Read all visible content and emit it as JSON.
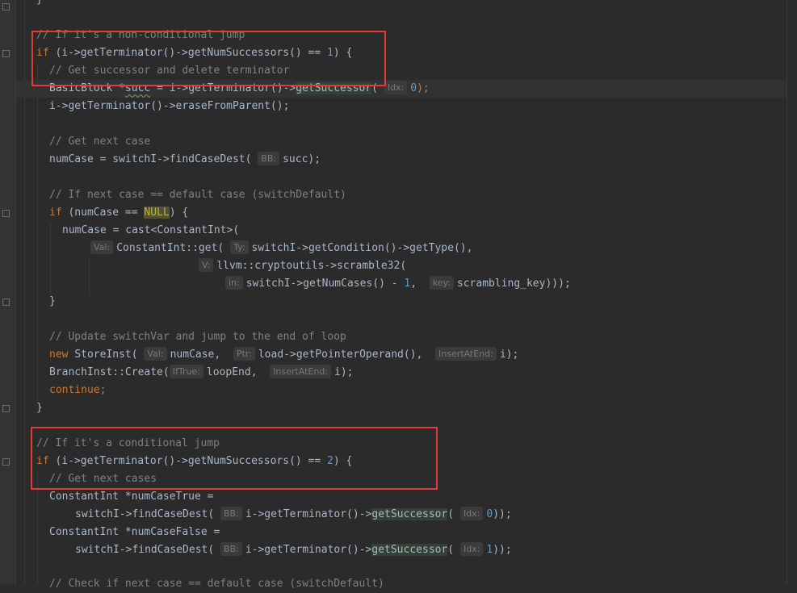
{
  "code": {
    "l1_comment": "// If it's a non-conditional jump",
    "l2_if": "if",
    "l2_a": " (i->getTerminator()->getNumSuccessors() == ",
    "l2_num": "1",
    "l2_b": ") {",
    "l3_comment": "// Get successor and delete terminator",
    "l4_a": "BasicBlock *",
    "l4_succ": "succ",
    "l4_b": " = i->getTerminator()->",
    "l4_fn": "getSuccessor",
    "l4_c": "(",
    "l4_hint": "Idx:",
    "l4_num": "0",
    "l4_d": ");",
    "l5": "i->getTerminator()->eraseFromParent();",
    "l7_comment": "// Get next case",
    "l8_a": "numCase = switchI->findCaseDest(",
    "l8_hint": "BB:",
    "l8_b": "succ);",
    "l10_comment": "// If next case == default case (switchDefault)",
    "l11_if": "if",
    "l11_a": " (numCase == ",
    "l11_null": "NULL",
    "l11_b": ") {",
    "l12": "numCase = cast<ConstantInt>(",
    "l13_hint1": "Val:",
    "l13_a": "ConstantInt::get(",
    "l13_hint2": "Ty:",
    "l13_b": "switchI->getCondition()->getType(),",
    "l14_hint": "V:",
    "l14_a": "llvm::cryptoutils->scramble32(",
    "l15_hint1": "in:",
    "l15_a": "switchI->getNumCases() - ",
    "l15_num": "1",
    "l15_b": ", ",
    "l15_hint2": "key:",
    "l15_c": "scrambling_key)));",
    "l16": "}",
    "l18_comment": "// Update switchVar and jump to the end of loop",
    "l19_new": "new",
    "l19_a": " StoreInst(",
    "l19_hint1": "Val:",
    "l19_b": "numCase, ",
    "l19_hint2": "Ptr:",
    "l19_c": "load->getPointerOperand(), ",
    "l19_hint3": "InsertAtEnd:",
    "l19_d": "i);",
    "l20_a": "BranchInst::Create(",
    "l20_hint1": "IfTrue:",
    "l20_b": "loopEnd, ",
    "l20_hint2": "InsertAtEnd:",
    "l20_c": "i);",
    "l21": "continue;",
    "l22": "}",
    "l24_comment": "// If it's a conditional jump",
    "l25_if": "if",
    "l25_a": " (i->getTerminator()->getNumSuccessors() == ",
    "l25_num": "2",
    "l25_b": ") {",
    "l26_comment": "// Get next cases",
    "l27": "ConstantInt *numCaseTrue =",
    "l28_a": "switchI->findCaseDest(",
    "l28_hint1": "BB:",
    "l28_b": "i->getTerminator()->",
    "l28_fn": "getSuccessor",
    "l28_c": "(",
    "l28_hint2": "Idx:",
    "l28_num": "0",
    "l28_d": "));",
    "l29": "ConstantInt *numCaseFalse =",
    "l30_a": "switchI->findCaseDest(",
    "l30_hint1": "BB:",
    "l30_b": "i->getTerminator()->",
    "l30_fn": "getSuccessor",
    "l30_c": "(",
    "l30_hint2": "Idx:",
    "l30_num": "1",
    "l30_d": "));",
    "l32_comment": "// Check if next case == default case (switchDefault)"
  },
  "colors": {
    "background": "#2b2b2b",
    "keyword": "#cc7832",
    "comment": "#808080",
    "number": "#6897bb",
    "highlight_box": "#e53935"
  }
}
